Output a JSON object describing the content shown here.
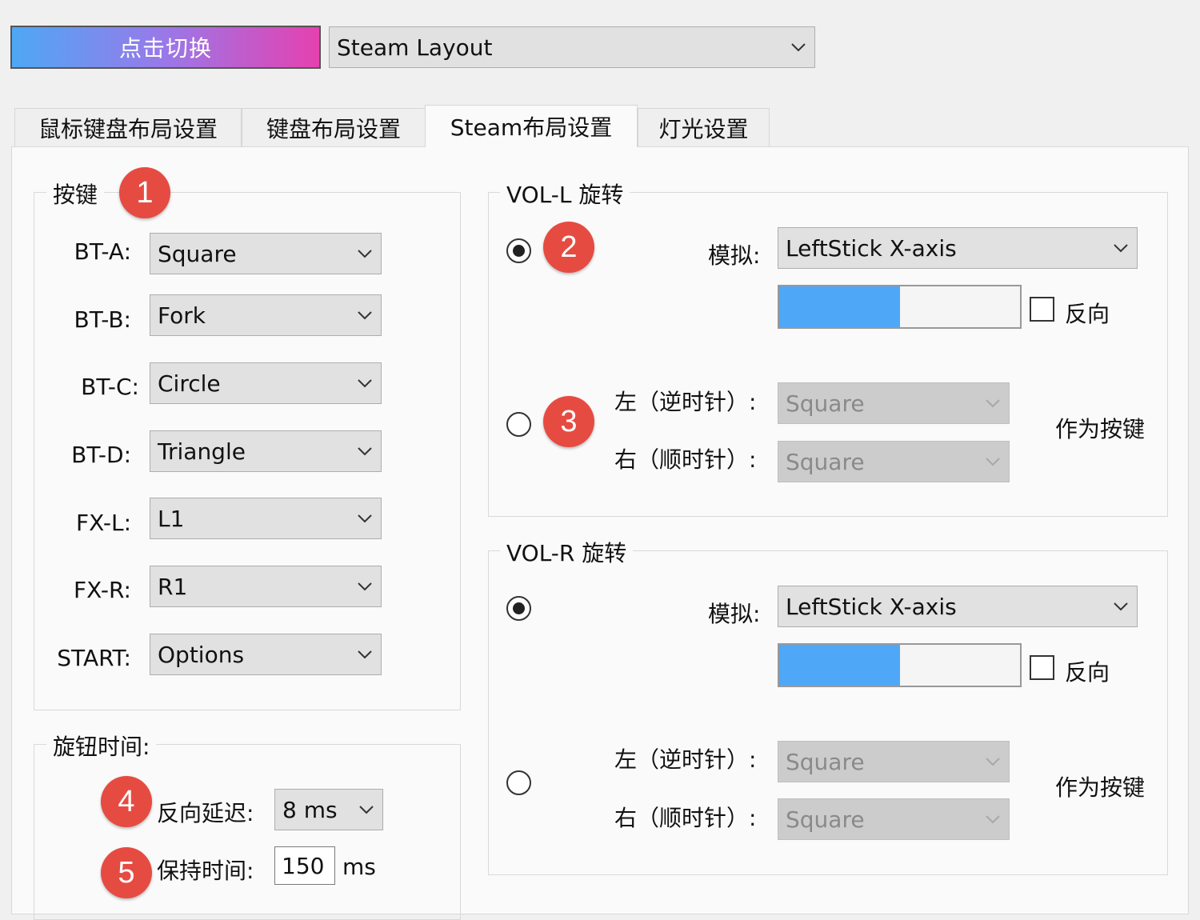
{
  "header": {
    "switch_button": "点击切换",
    "layout_select": "Steam Layout"
  },
  "tabs": [
    {
      "label": "鼠标键盘布局设置"
    },
    {
      "label": "键盘布局设置"
    },
    {
      "label": "Steam布局设置",
      "active": true
    },
    {
      "label": "灯光设置"
    }
  ],
  "buttons": {
    "title": "按键",
    "rows": [
      {
        "label": "BT-A:",
        "value": "Square"
      },
      {
        "label": "BT-B:",
        "value": "Fork"
      },
      {
        "label": "BT-C:",
        "value": "Circle"
      },
      {
        "label": "BT-D:",
        "value": "Triangle"
      },
      {
        "label": "FX-L:",
        "value": "L1"
      },
      {
        "label": "FX-R:",
        "value": "R1"
      },
      {
        "label": "START:",
        "value": "Options"
      }
    ]
  },
  "knob_time": {
    "title": "旋钮时间:",
    "reverse_delay_label": "反向延迟:",
    "reverse_delay_value": "8 ms",
    "hold_time_label": "保持时间:",
    "hold_time_value": "150",
    "hold_time_unit": "ms"
  },
  "vol_l": {
    "title": "VOL-L 旋转",
    "analog_label": "模拟:",
    "analog_value": "LeftStick X-axis",
    "sensitivity": 0.5,
    "reverse_label": "反向",
    "left_label": "左（逆时针）:",
    "left_value": "Square",
    "right_label": "右（顺时针）:",
    "right_value": "Square",
    "as_key_label": "作为按键",
    "mode": "analog"
  },
  "vol_r": {
    "title": "VOL-R 旋转",
    "analog_label": "模拟:",
    "analog_value": "LeftStick X-axis",
    "sensitivity": 0.5,
    "reverse_label": "反向",
    "left_label": "左（逆时针）:",
    "left_value": "Square",
    "right_label": "右（顺时针）:",
    "right_value": "Square",
    "as_key_label": "作为按键",
    "mode": "analog"
  },
  "badges": [
    "1",
    "2",
    "3",
    "4",
    "5"
  ],
  "colors": {
    "badge": "#e64b42",
    "slider_fill": "#4fa7f7",
    "switch_gradient_start": "#4ea8f5",
    "switch_gradient_end": "#e541b0"
  }
}
